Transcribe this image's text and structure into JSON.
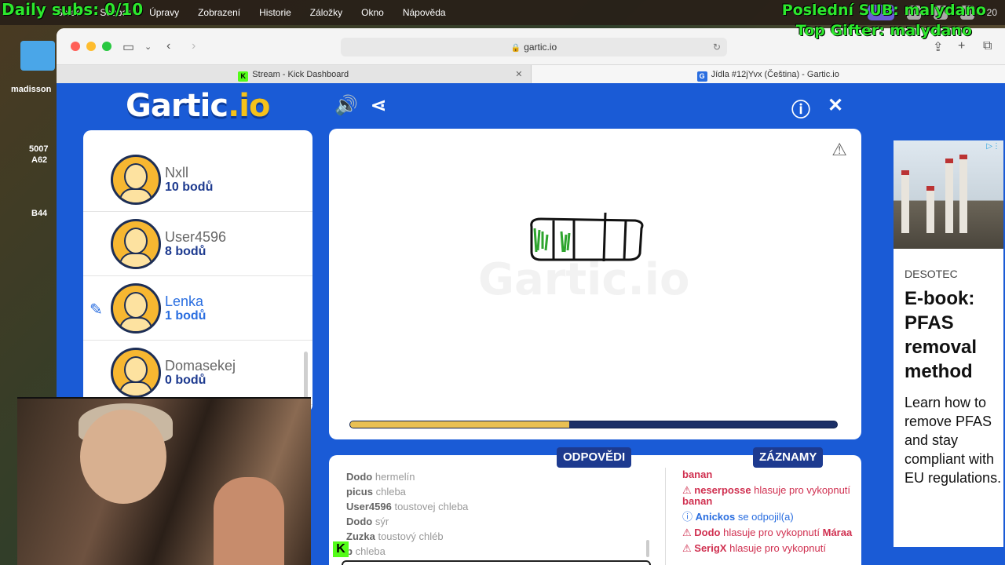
{
  "overlay": {
    "daily_subs": "Daily subs: 0/10",
    "last_sub": "Poslední SUB: malydano",
    "top_gifter": "Top Gifter: malydano"
  },
  "menubar": {
    "items": [
      "Safari",
      "Soubor",
      "Úpravy",
      "Zobrazení",
      "Historie",
      "Záložky",
      "Okno",
      "Nápověda"
    ],
    "time": "20"
  },
  "desktop": {
    "folder_label": "madisson",
    "label_a": "5007",
    "label_b": "A62",
    "label_c": "B44"
  },
  "browser": {
    "url": "gartic.io",
    "tabs": [
      {
        "title": "Stream - Kick Dashboard",
        "favicon": "K",
        "color": "#53fc18"
      },
      {
        "title": "Jídla #12jYvx (Čeština) - Gartic.io",
        "favicon": "G",
        "color": "#2a6ee0"
      }
    ]
  },
  "game": {
    "logo_main": "Gartic",
    "logo_accent": ".io",
    "watermark": "Gartic.io",
    "players": [
      {
        "name": "Nxll",
        "points": "10 bodů",
        "drawing": false
      },
      {
        "name": "User4596",
        "points": "8 bodů",
        "drawing": false
      },
      {
        "name": "Lenka",
        "points": "1 bodů",
        "drawing": true
      },
      {
        "name": "Domasekej",
        "points": "0 bodů",
        "drawing": false
      }
    ],
    "timer_fraction": 0.45,
    "answers_label": "ODPOVĚDI",
    "records_label": "ZÁZNAMY",
    "answers": [
      {
        "user": "Dodo",
        "text": "hermelín"
      },
      {
        "user": "picus",
        "text": "chleba"
      },
      {
        "user": "User4596",
        "text": "toustovej chleba"
      },
      {
        "user": "Dodo",
        "text": "sýr"
      },
      {
        "user": "Zuzka",
        "text": "toustový chléb"
      },
      {
        "user": "b",
        "text": "chleba"
      }
    ],
    "records": [
      {
        "type": "vote",
        "user": "",
        "text": "",
        "target": "banan"
      },
      {
        "type": "vote",
        "user": "neserposse",
        "text": "hlasuje pro vykopnutí",
        "target": "banan"
      },
      {
        "type": "join",
        "user": "Anickos",
        "text": "se odpojil(a)",
        "target": ""
      },
      {
        "type": "vote",
        "user": "Dodo",
        "text": "hlasuje pro vykopnutí",
        "target": "Máraa"
      },
      {
        "type": "vote",
        "user": "SerigX",
        "text": "hlasuje pro vykopnutí",
        "target": ""
      }
    ]
  },
  "ad": {
    "brand": "DESOTEC",
    "title": "E-book: PFAS removal method",
    "body": "Learn how to remove PFAS and stay compliant with EU regulations."
  },
  "kick_badge": "K"
}
